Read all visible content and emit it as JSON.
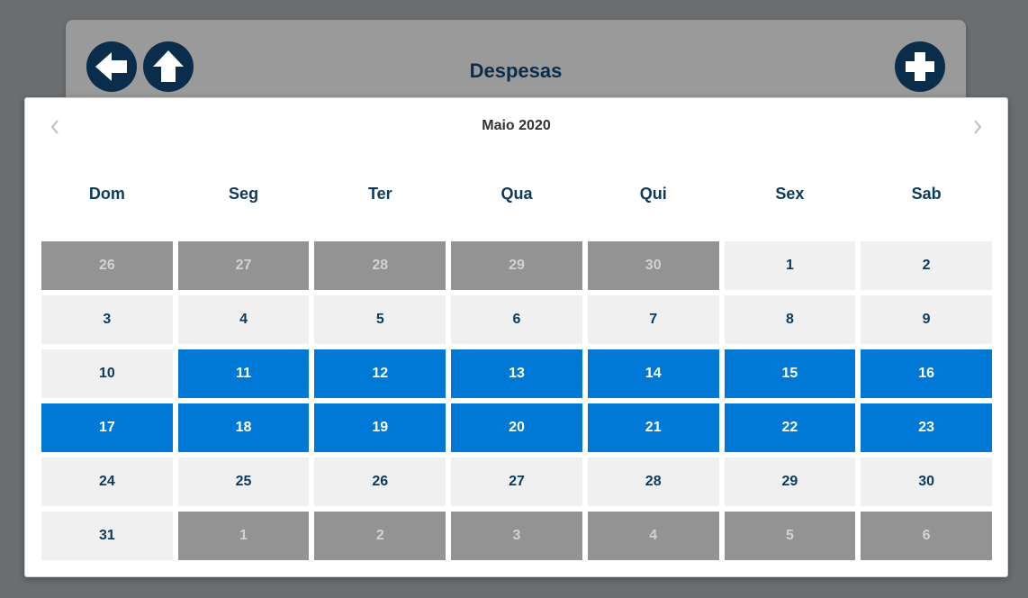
{
  "header": {
    "title": "Despesas",
    "back_icon": "arrow-left-icon",
    "home_icon": "arrow-up-icon",
    "add_icon": "plus-icon"
  },
  "calendar": {
    "month_label": "Maio 2020",
    "prev_icon": "chevron-left-icon",
    "next_icon": "chevron-right-icon",
    "weekdays": [
      "Dom",
      "Seg",
      "Ter",
      "Qua",
      "Qui",
      "Sex",
      "Sab"
    ],
    "days": [
      {
        "label": "26",
        "state": "other"
      },
      {
        "label": "27",
        "state": "other"
      },
      {
        "label": "28",
        "state": "other"
      },
      {
        "label": "29",
        "state": "other"
      },
      {
        "label": "30",
        "state": "other"
      },
      {
        "label": "1",
        "state": "normal"
      },
      {
        "label": "2",
        "state": "normal"
      },
      {
        "label": "3",
        "state": "normal"
      },
      {
        "label": "4",
        "state": "normal"
      },
      {
        "label": "5",
        "state": "normal"
      },
      {
        "label": "6",
        "state": "normal"
      },
      {
        "label": "7",
        "state": "normal"
      },
      {
        "label": "8",
        "state": "normal"
      },
      {
        "label": "9",
        "state": "normal"
      },
      {
        "label": "10",
        "state": "normal"
      },
      {
        "label": "11",
        "state": "selected"
      },
      {
        "label": "12",
        "state": "selected"
      },
      {
        "label": "13",
        "state": "selected"
      },
      {
        "label": "14",
        "state": "selected"
      },
      {
        "label": "15",
        "state": "selected"
      },
      {
        "label": "16",
        "state": "selected"
      },
      {
        "label": "17",
        "state": "selected"
      },
      {
        "label": "18",
        "state": "selected"
      },
      {
        "label": "19",
        "state": "selected"
      },
      {
        "label": "20",
        "state": "selected"
      },
      {
        "label": "21",
        "state": "selected"
      },
      {
        "label": "22",
        "state": "selected"
      },
      {
        "label": "23",
        "state": "selected"
      },
      {
        "label": "24",
        "state": "normal"
      },
      {
        "label": "25",
        "state": "normal"
      },
      {
        "label": "26",
        "state": "normal"
      },
      {
        "label": "27",
        "state": "normal"
      },
      {
        "label": "28",
        "state": "normal"
      },
      {
        "label": "29",
        "state": "normal"
      },
      {
        "label": "30",
        "state": "normal"
      },
      {
        "label": "31",
        "state": "normal"
      },
      {
        "label": "1",
        "state": "other"
      },
      {
        "label": "2",
        "state": "other"
      },
      {
        "label": "3",
        "state": "other"
      },
      {
        "label": "4",
        "state": "other"
      },
      {
        "label": "5",
        "state": "other"
      },
      {
        "label": "6",
        "state": "other"
      }
    ]
  },
  "colors": {
    "background": "#6b6e70",
    "header_bg": "#9a9a9a",
    "brand_dark": "#0b2d4c",
    "selected": "#0079d6",
    "day_normal_bg": "#f0f0f0",
    "day_other_bg": "#939393"
  }
}
